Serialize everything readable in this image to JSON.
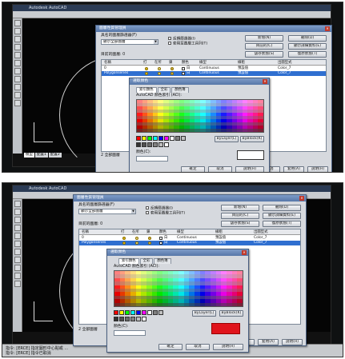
{
  "app": {
    "window_title": "Autodesk AutoCAD",
    "status_line1": "指令: [ERCE] 指定圖形中心點或 ...",
    "status_line2": "指令: [ERCE] 指令已取消",
    "tabs": [
      "模型",
      "配置1",
      "配置2"
    ]
  },
  "layer_manager": {
    "title": "圖層性質管理員",
    "current_layer_label": "目前的圖層: 0",
    "filter_label": "具名的圖層篩選器(F)",
    "filter_value": "顯示全部圖層",
    "invert_filter_label": "反轉篩選器(I)",
    "apply_toolbar_label": "套用至圖層工具列(T)",
    "columns": [
      "名稱",
      "打",
      "在所",
      "鎖",
      "顏色",
      "線型",
      "線粗",
      "出圖型式"
    ],
    "rows": [
      {
        "name": "0",
        "color": "白",
        "linetype": "Continuous",
        "lineweight": "預設值",
        "plotstyle": "Color_7"
      },
      {
        "name": "Polygonseries",
        "color": "白",
        "linetype": "Continuous",
        "lineweight": "預設值",
        "plotstyle": "Color_7"
      }
    ],
    "buttons": {
      "new": "新增(N)",
      "delete": "刪除(D)",
      "current": "目前的(C)",
      "show_details": "顯示詳細資料(E)",
      "save_state": "儲存狀態(S)",
      "restore_state": "復原狀態(T)"
    },
    "all_layers_label": "2 全部圖層",
    "plotstyle_label": "出圖型式",
    "ok": "確定",
    "cancel": "取消",
    "apply": "套用(A)",
    "help": "說明(H)"
  },
  "color_dialog": {
    "title": "選取顏色",
    "tabs": [
      "索引顏色",
      "全彩",
      "顏色簿"
    ],
    "index_label": "AutoCAD 顏色索引 (ACI):",
    "color_label": "顏色(C):",
    "bylayer": "ByLayer(L)",
    "byblock": "ByBlock(K)",
    "ok": "確定",
    "cancel": "取消",
    "help": "說明(H)",
    "preview_color_top": "#ffffff",
    "preview_color_bottom": "#e0141c"
  },
  "colors": {
    "title_bar": "#5677a8",
    "selection": "#2f6fd0",
    "canvas": "#050505"
  }
}
